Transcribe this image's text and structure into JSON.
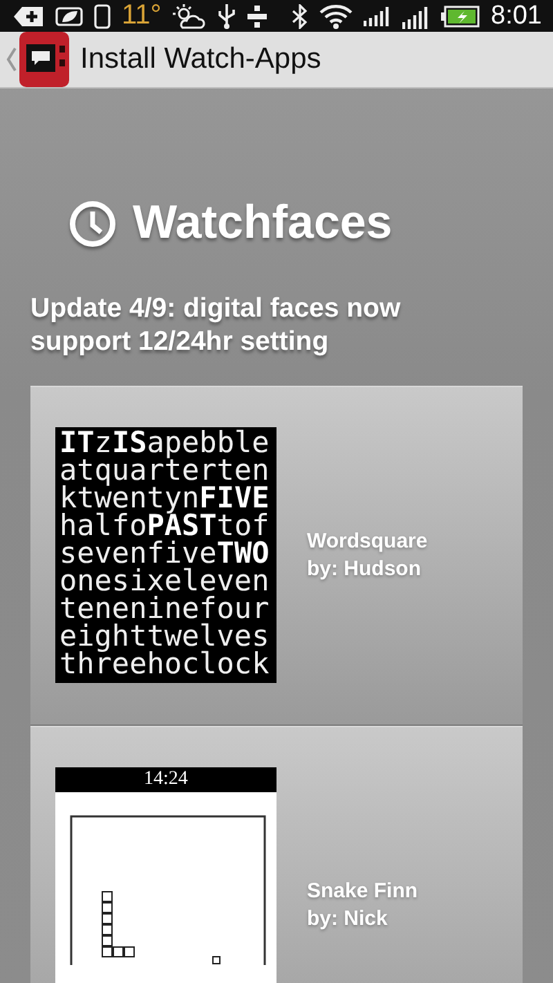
{
  "status_bar": {
    "temperature": "11°",
    "time": "8:01"
  },
  "action_bar": {
    "title": "Install Watch-Apps"
  },
  "header": {
    "title": "Watchfaces",
    "notice": "Update 4/9: digital faces now support 12/24hr setting"
  },
  "watchfaces": [
    {
      "kind": "wordsquare",
      "name": "Wordsquare",
      "author": "by: Hudson",
      "lines": [
        "**IT**z**IS**apebble",
        "atquarterten",
        "ktwentyn**FIVE**",
        "halfo**PAST**tof",
        "sevenfive**TWO**",
        "onesixeleven",
        "teneninefour",
        "eighttwelves",
        "threehoclock"
      ]
    },
    {
      "kind": "snake",
      "name": "Snake Finn",
      "author": "by: Nick",
      "time": "14:24"
    }
  ]
}
